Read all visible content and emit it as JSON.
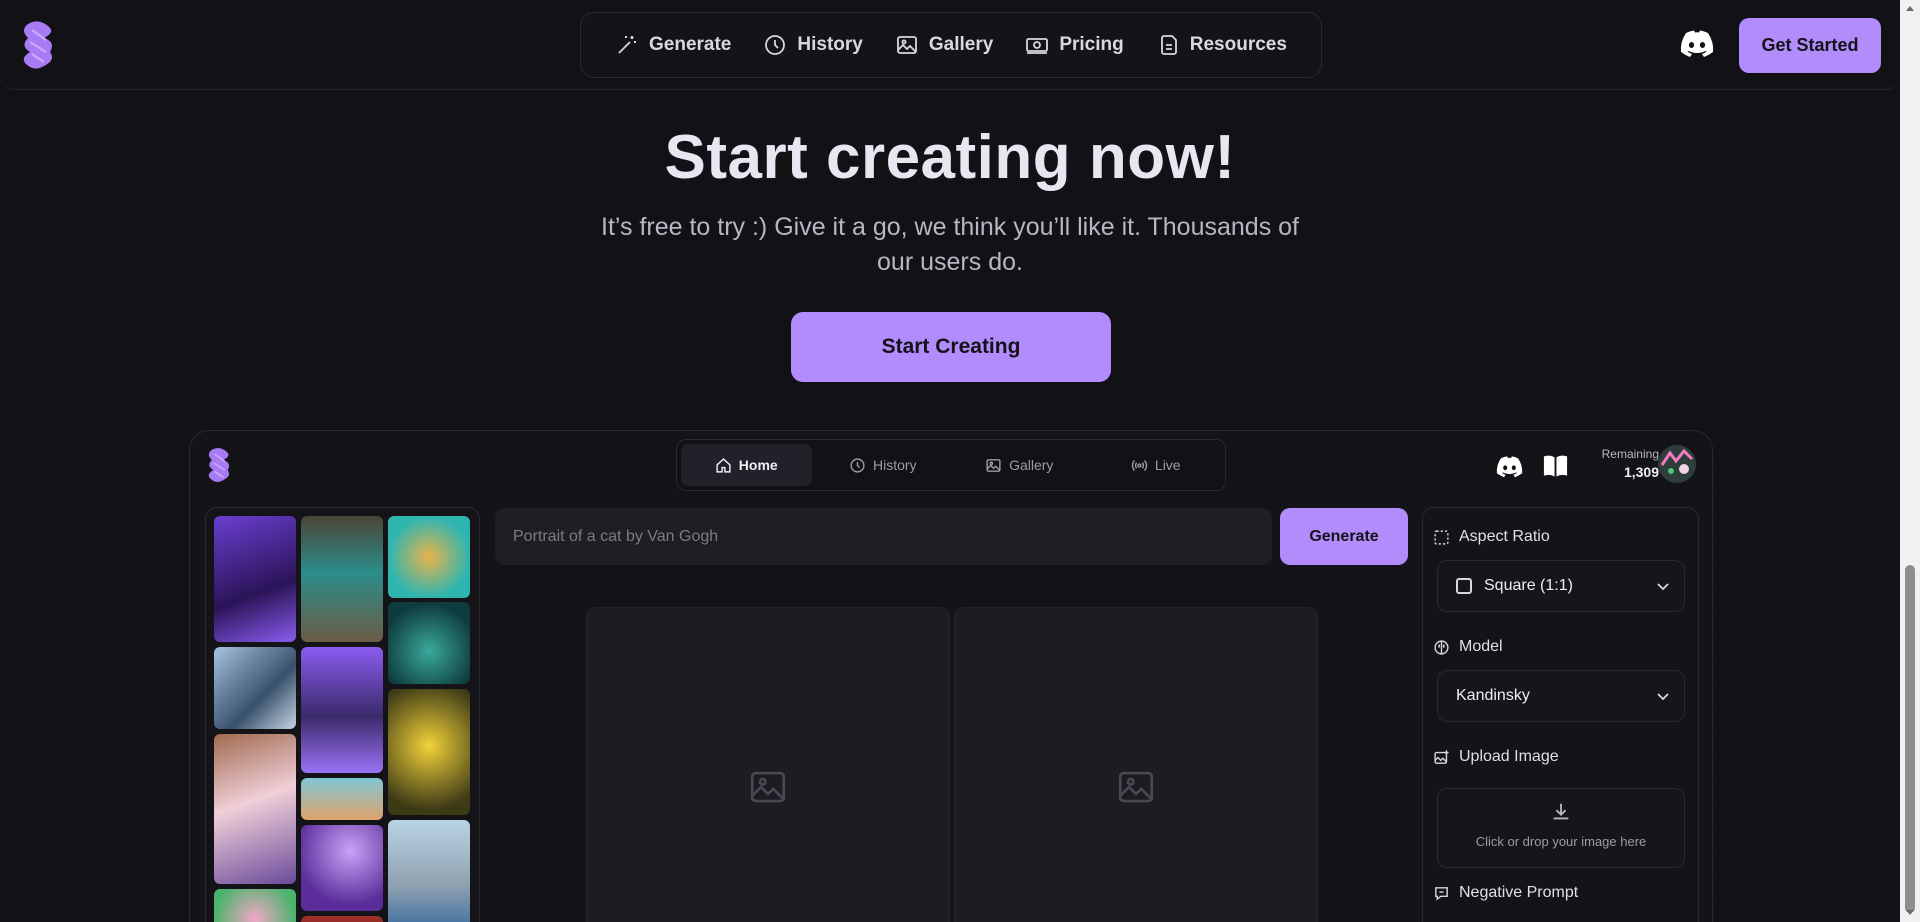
{
  "topnav": {
    "items": [
      {
        "label": "Generate",
        "icon": "magic-wand-icon"
      },
      {
        "label": "History",
        "icon": "history-icon"
      },
      {
        "label": "Gallery",
        "icon": "image-icon"
      },
      {
        "label": "Pricing",
        "icon": "money-icon"
      },
      {
        "label": "Resources",
        "icon": "documents-icon"
      }
    ],
    "cta_label": "Get Started"
  },
  "hero": {
    "title": "Start creating now!",
    "subtitle": "It’s free to try :) Give it a go, we think you’ll like it. Thousands of our users do.",
    "cta_label": "Start Creating"
  },
  "app": {
    "tabs": [
      {
        "label": "Home",
        "icon": "home-icon",
        "active": true
      },
      {
        "label": "History",
        "icon": "history-icon",
        "active": false
      },
      {
        "label": "Gallery",
        "icon": "image-icon",
        "active": false
      },
      {
        "label": "Live",
        "icon": "broadcast-icon",
        "active": false
      }
    ],
    "remaining_label": "Remaining",
    "remaining_value": "1,309",
    "prompt_placeholder": "Portrait of a cat by Van Gogh",
    "generate_label": "Generate",
    "settings": {
      "aspect_ratio_label": "Aspect Ratio",
      "aspect_ratio_value": "Square (1:1)",
      "model_label": "Model",
      "model_value": "Kandinsky",
      "upload_label": "Upload Image",
      "upload_hint": "Click or drop your image here",
      "negative_prompt_label": "Negative Prompt"
    }
  },
  "colors": {
    "accent": "#b38cfb",
    "background": "#121116",
    "panel": "#1f1e24"
  }
}
